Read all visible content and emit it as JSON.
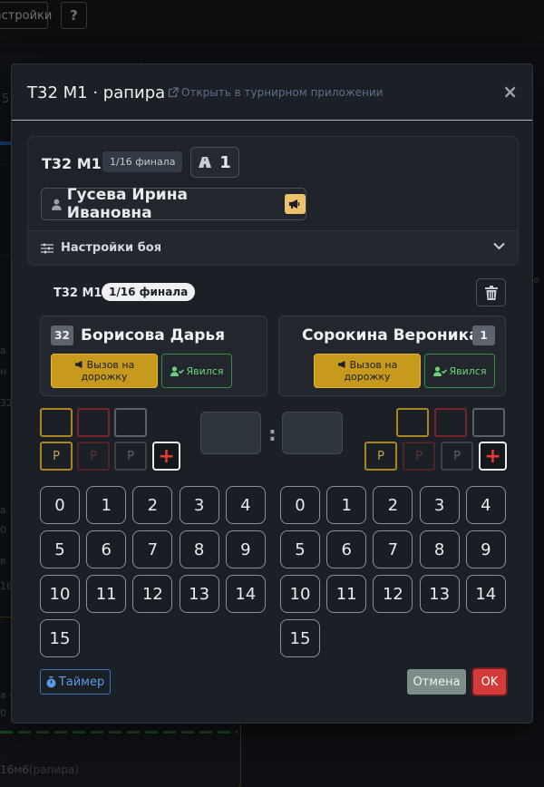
{
  "background": {
    "settings_label": "астройки",
    "help_label": "?",
    "side_texts": [
      "5",
      "а",
      "н",
      "32",
      "а 1",
      "0",
      "в",
      "16",
      "а 4",
      "0",
      "16м6"
    ],
    "side_text_right": "e",
    "footer_text": "16м6",
    "footer_weapon": "(рапира)"
  },
  "modal": {
    "title": "Т32 М1 · рапира",
    "open_link": "Открыть в турнирном приложении",
    "close": "×"
  },
  "bout": {
    "code": "Т32 М1",
    "round": "1/16 финала",
    "piste": "1",
    "referee": "Гусева Ирина Ивановна",
    "settings_label": "Настройки боя"
  },
  "sub_header": {
    "code": "Т32 М1",
    "round": "1/16 финала"
  },
  "fencers": {
    "left": {
      "seed": "32",
      "name": "Борисова Дарья",
      "call_label": "Вызов на дорожку",
      "appear_label": "Явился"
    },
    "right": {
      "seed": "1",
      "name": "Сорокина Вероника",
      "call_label": "Вызов на дорожку",
      "appear_label": "Явился"
    }
  },
  "penalty_label": "P",
  "plus_label": "+",
  "score_separator": ":",
  "keypad": [
    "0",
    "1",
    "2",
    "3",
    "4",
    "5",
    "6",
    "7",
    "8",
    "9",
    "10",
    "11",
    "12",
    "13",
    "14",
    "15"
  ],
  "footer": {
    "timer_label": "Таймер",
    "cancel_label": "Отмена",
    "ok_label": "OK"
  },
  "colors": {
    "accent_gold": "#c79a1e",
    "success_green": "#3a8a45",
    "danger_red": "#d33a3a",
    "info_blue": "#3b72c0"
  }
}
